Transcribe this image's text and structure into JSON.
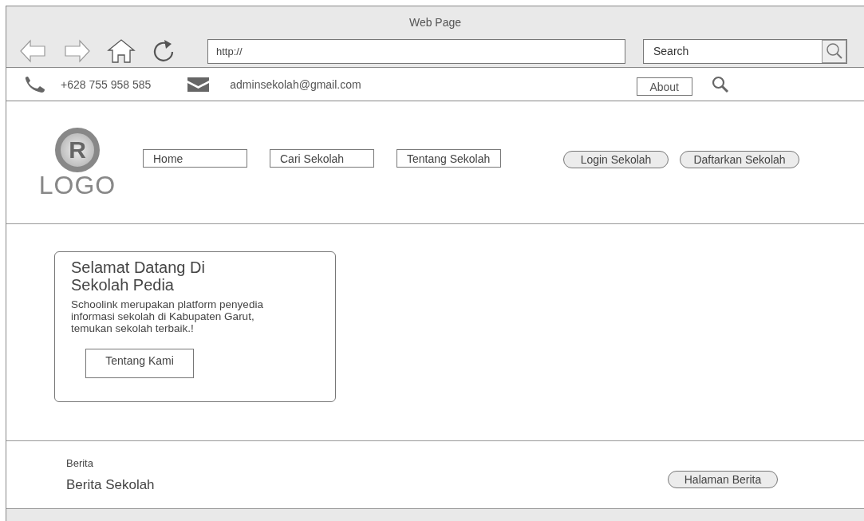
{
  "window": {
    "title": "Web Page"
  },
  "browser": {
    "address": "http://",
    "search_placeholder": "Search"
  },
  "contact_bar": {
    "phone": "+628 755 958 585",
    "email": "adminsekolah@gmail.com",
    "about": "About"
  },
  "header": {
    "logo_mark": "R",
    "logo_text": "LOGO",
    "nav": [
      {
        "label": "Home"
      },
      {
        "label": "Cari Sekolah"
      },
      {
        "label": "Tentang Sekolah"
      }
    ],
    "actions": [
      {
        "label": "Login Sekolah"
      },
      {
        "label": "Daftarkan Sekolah"
      }
    ]
  },
  "hero": {
    "title": "Selamat Datang Di Sekolah Pedia",
    "text": "Schoolink merupakan platform penyedia informasi sekolah di Kabupaten Garut, temukan sekolah terbaik.!",
    "button": "Tentang Kami"
  },
  "news": {
    "label": "Berita",
    "title": "Berita Sekolah",
    "button": "Halaman Berita"
  }
}
